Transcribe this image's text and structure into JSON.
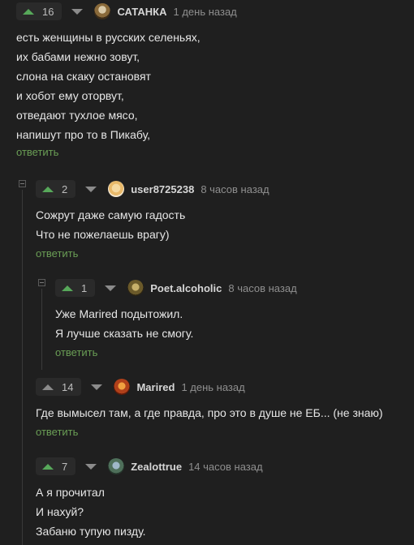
{
  "comments": [
    {
      "score": "16",
      "author": "САТАНКА",
      "time": "1 день назад",
      "lines": [
        "есть женщины в русских селеньях,",
        "их бабами нежно зовут,",
        "слона на скаку остановят",
        "и хобот ему оторвут,",
        "отведают тухлое мясо,",
        "напишут про то в Пикабу,"
      ],
      "reply": "ответить"
    },
    {
      "score": "2",
      "author": "user8725238",
      "time": "8 часов назад",
      "lines": [
        "Сожрут даже самую гадость",
        "Что не пожелаешь врагу)"
      ],
      "reply": "ответить"
    },
    {
      "score": "1",
      "author": "Poet.alcoholic",
      "time": "8 часов назад",
      "lines": [
        "Уже Marired подытожил.",
        "Я лучше сказать не смогу."
      ],
      "reply": "ответить"
    },
    {
      "score": "14",
      "author": "Marired",
      "time": "1 день назад",
      "lines": [
        "Где вымысел там, а где правда, про это в душе не ЕБ... (не знаю)"
      ],
      "reply": "ответить"
    },
    {
      "score": "7",
      "author": "Zealottrue",
      "time": "14 часов назад",
      "lines": [
        "А я прочитал",
        "И нахуй?",
        "Забаню тупую пизду."
      ],
      "reply": ""
    }
  ],
  "colors": {
    "upvote": "#57a85a",
    "reply_link": "#6a9e55"
  }
}
